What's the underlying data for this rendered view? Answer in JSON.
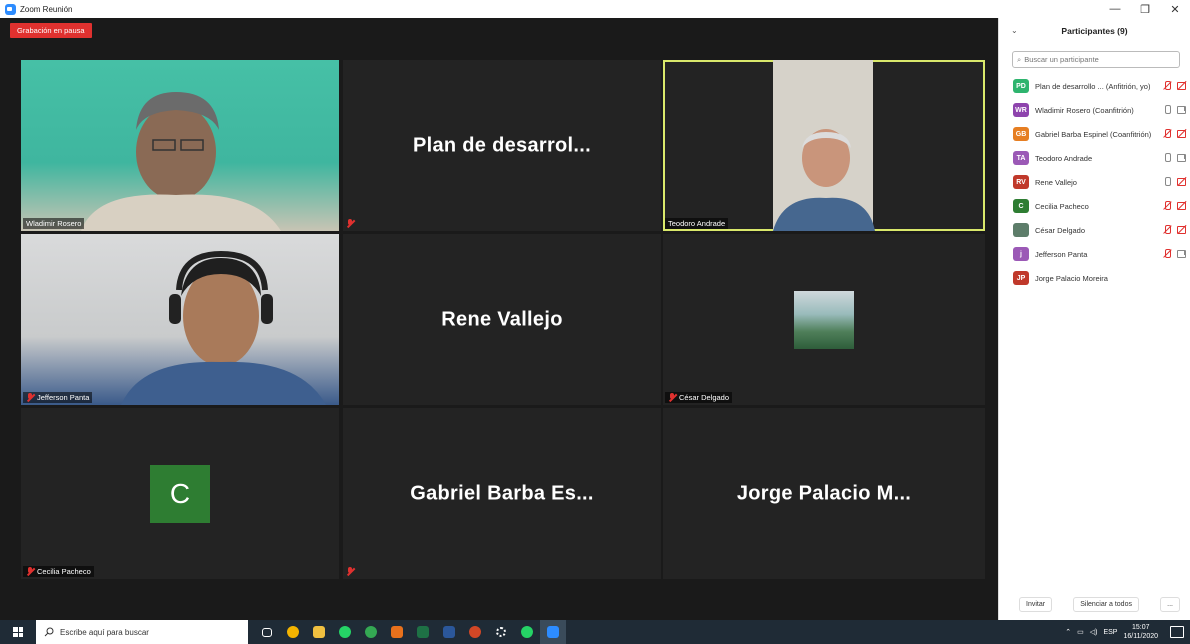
{
  "window": {
    "title": "Zoom Reunión",
    "minimize": "—",
    "restore": "❐",
    "close": "✕"
  },
  "recording": {
    "label": "Grabación en pausa"
  },
  "tiles": [
    {
      "name": "Wladimir Rosero",
      "type": "video"
    },
    {
      "name": "Plan de desarrol...",
      "type": "name"
    },
    {
      "name": "Teodoro Andrade",
      "type": "video",
      "active": true
    },
    {
      "name": "Jefferson Panta",
      "type": "video"
    },
    {
      "name": "Rene Vallejo",
      "type": "name"
    },
    {
      "name": "César Delgado",
      "type": "picture"
    },
    {
      "name": "Cecilia Pacheco",
      "type": "avatar",
      "avatar_letter": "C"
    },
    {
      "name": "Gabriel Barba Es...",
      "type": "name"
    },
    {
      "name": "Jorge Palacio M...",
      "type": "name"
    }
  ],
  "panel": {
    "title": "Participantes (9)",
    "search_placeholder": "Buscar un participante",
    "participants": [
      {
        "initials": "PD",
        "color": "#2eb46e",
        "name": "Plan de desarrollo ... (Anfitrión, yo)",
        "mic": "muted",
        "cam": "muted"
      },
      {
        "initials": "WR",
        "color": "#8e44ad",
        "name": "Wladimir Rosero (Coanfitrión)",
        "mic": "on",
        "cam": "on"
      },
      {
        "initials": "GB",
        "color": "#e67e22",
        "name": "Gabriel Barba Espinel (Coanfitrión)",
        "mic": "muted",
        "cam": "muted"
      },
      {
        "initials": "TA",
        "color": "#9b59b6",
        "name": "Teodoro Andrade",
        "mic": "on",
        "cam": "on"
      },
      {
        "initials": "RV",
        "color": "#c0392b",
        "name": "Rene Vallejo",
        "mic": "on",
        "cam": "muted"
      },
      {
        "initials": "C",
        "color": "#2e7d32",
        "name": "Cecilia Pacheco",
        "mic": "muted",
        "cam": "muted"
      },
      {
        "initials": "",
        "color": "#5d7d6a",
        "name": "César Delgado",
        "mic": "muted",
        "cam": "muted"
      },
      {
        "initials": "j",
        "color": "#9b59b6",
        "name": "Jefferson Panta",
        "mic": "muted",
        "cam": "on"
      },
      {
        "initials": "JP",
        "color": "#c0392b",
        "name": "Jorge Palacio Moreira",
        "mic": "",
        "cam": ""
      }
    ],
    "invite": "Invitar",
    "mute_all": "Silenciar a todos",
    "more": "..."
  },
  "taskbar": {
    "search_placeholder": "Escribe aquí para buscar",
    "apps": [
      {
        "name": "task-view-icon",
        "color": "#ffffff"
      },
      {
        "name": "chrome-icon",
        "color": "#f4b400"
      },
      {
        "name": "file-explorer-icon",
        "color": "#f0c040"
      },
      {
        "name": "whatsapp-icon",
        "color": "#25d366"
      },
      {
        "name": "browser-icon",
        "color": "#34a853"
      },
      {
        "name": "office-icon",
        "color": "#e8711c"
      },
      {
        "name": "excel-icon",
        "color": "#1e7145"
      },
      {
        "name": "word-icon",
        "color": "#2b579a"
      },
      {
        "name": "powerpoint-icon",
        "color": "#d24726"
      },
      {
        "name": "settings-icon",
        "color": "#ffffff"
      },
      {
        "name": "whatsapp-icon",
        "color": "#25d366"
      },
      {
        "name": "zoom-icon",
        "color": "#2d8cff"
      }
    ],
    "tray_lang": "ESP",
    "time": "15:07",
    "date": "16/11/2020"
  }
}
